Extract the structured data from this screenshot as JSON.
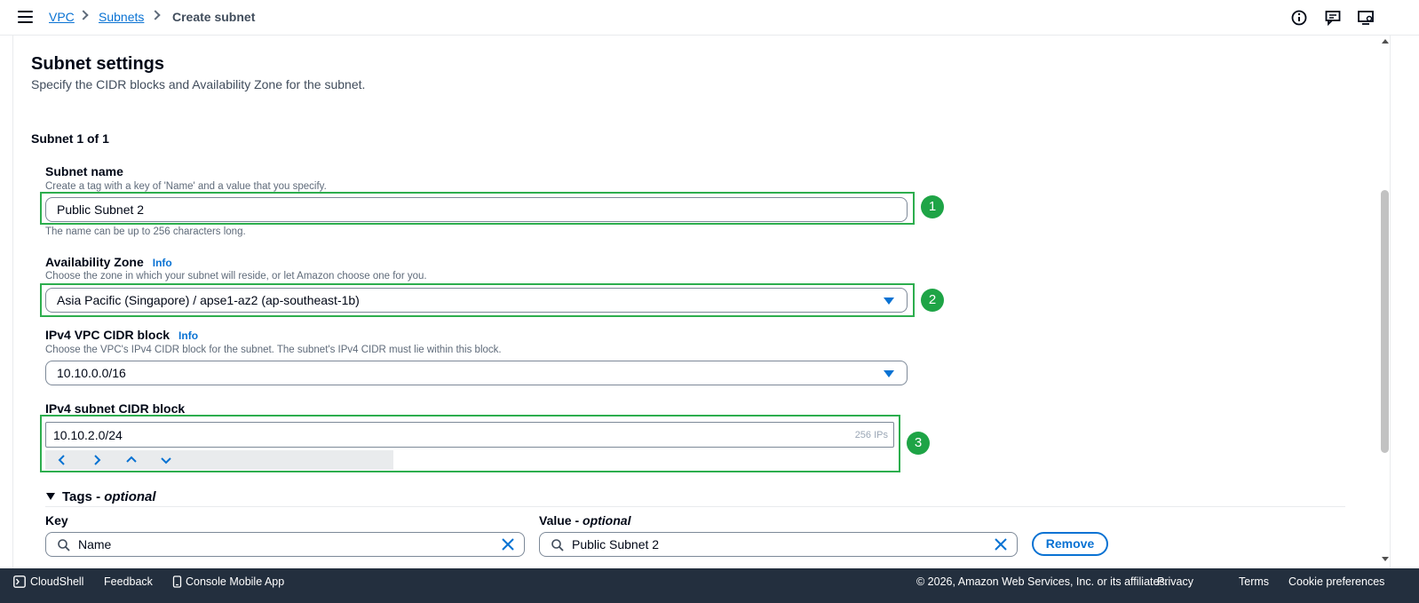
{
  "breadcrumb": {
    "items": [
      "VPC",
      "Subnets"
    ],
    "current": "Create subnet"
  },
  "section": {
    "title": "Subnet settings",
    "description": "Specify the CIDR blocks and Availability Zone for the subnet.",
    "subnet_count": "Subnet 1 of 1"
  },
  "subnet_name": {
    "label": "Subnet name",
    "hint": "Create a tag with a key of 'Name' and a value that you specify.",
    "value": "Public Subnet 2",
    "constraint": "The name can be up to 256 characters long.",
    "badge": "1"
  },
  "availability_zone": {
    "label": "Availability Zone",
    "info": "Info",
    "hint": "Choose the zone in which your subnet will reside, or let Amazon choose one for you.",
    "value": "Asia Pacific (Singapore) / apse1-az2 (ap-southeast-1b)",
    "badge": "2"
  },
  "vpc_cidr": {
    "label": "IPv4 VPC CIDR block",
    "info": "Info",
    "hint": "Choose the VPC's IPv4 CIDR block for the subnet. The subnet's IPv4 CIDR must lie within this block.",
    "value": "10.10.0.0/16"
  },
  "subnet_cidr": {
    "label": "IPv4 subnet CIDR block",
    "value": "10.10.2.0/24",
    "ip_count": "256 IPs",
    "badge": "3"
  },
  "tags": {
    "heading": "Tags -",
    "heading_optional": "optional",
    "key_label": "Key",
    "value_label": "Value -",
    "value_label_optional": "optional",
    "key_value": "Name",
    "value_value": "Public Subnet 2",
    "remove_label": "Remove"
  },
  "footer": {
    "cloudshell": "CloudShell",
    "feedback": "Feedback",
    "mobile_app": "Console Mobile App",
    "copyright": "© 2026, Amazon Web Services, Inc. or its affiliates.",
    "privacy": "Privacy",
    "terms": "Terms",
    "cookies": "Cookie preferences"
  },
  "colors": {
    "accent": "#0972d3",
    "highlight": "#2dae4e",
    "badge": "#1ea446",
    "footer_bg": "#232f3e"
  },
  "icons": [
    "menu-icon",
    "chevron-right-icon",
    "info-circle-icon",
    "feedback-icon",
    "display-settings-icon",
    "caret-down-icon",
    "search-icon",
    "close-icon",
    "arrow-left-icon",
    "arrow-right-icon",
    "arrow-up-icon",
    "arrow-down-icon",
    "terminal-icon",
    "mobile-app-icon"
  ]
}
